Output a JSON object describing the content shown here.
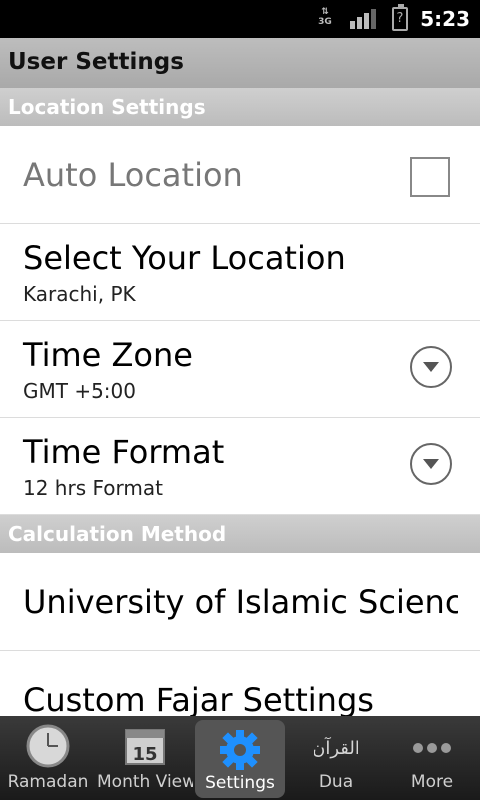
{
  "status_bar": {
    "network_label": "3G",
    "time": "5:23"
  },
  "header": {
    "title": "User Settings"
  },
  "sections": {
    "location": "Location Settings",
    "calculation": "Calculation Method"
  },
  "settings": {
    "auto_location": {
      "label": "Auto Location",
      "checked": false
    },
    "select_location": {
      "label": "Select Your Location",
      "value": "Karachi, PK"
    },
    "time_zone": {
      "label": "Time Zone",
      "value": "GMT +5:00"
    },
    "time_format": {
      "label": "Time Format",
      "value": "12 hrs Format"
    },
    "calculation_method": {
      "label": "University of Islamic Sciences"
    },
    "custom_fajar": {
      "label": "Custom Fajar Settings"
    }
  },
  "tabs": [
    {
      "label": "Ramadan",
      "icon": "clock-icon"
    },
    {
      "label": "Month View",
      "icon": "calendar-icon",
      "icon_text": "15"
    },
    {
      "label": "Settings",
      "icon": "gear-icon",
      "active": true
    },
    {
      "label": "Dua",
      "icon": "quran-icon",
      "icon_text": "القرآن"
    },
    {
      "label": "More",
      "icon": "more-dots-icon"
    }
  ],
  "colors": {
    "accent_active_tab": "#555555",
    "settings_icon_blue": "#1e90ff"
  }
}
